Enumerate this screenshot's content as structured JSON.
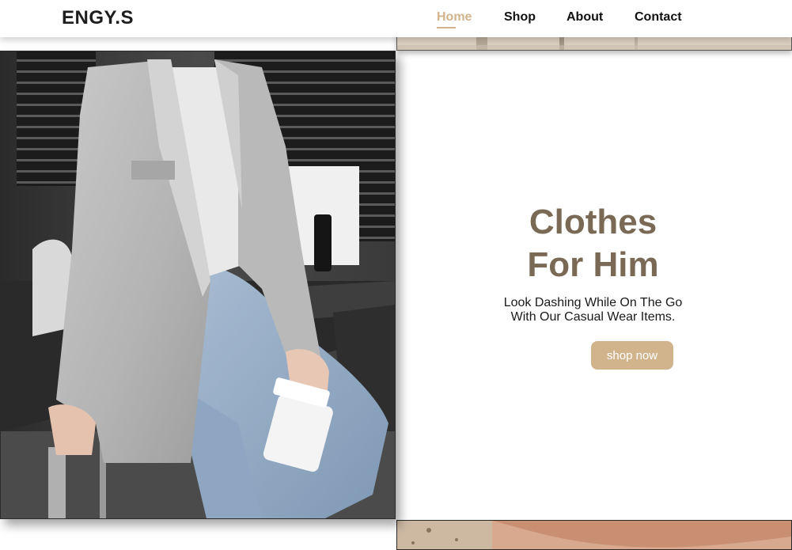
{
  "brand": {
    "logo": "ENGY.S",
    "accent_color": "#d2b48c",
    "title_color": "#7a6a55"
  },
  "nav": {
    "items": [
      {
        "label": "Home",
        "active": true
      },
      {
        "label": "Shop",
        "active": false
      },
      {
        "label": "About",
        "active": false
      },
      {
        "label": "Contact",
        "active": false
      }
    ]
  },
  "hero": {
    "title_line1": "Clothes",
    "title_line2": "For Him",
    "subtitle_line1": "Look Dashing While On The Go",
    "subtitle_line2": "With Our Casual Wear Items.",
    "cta_label": "shop now"
  },
  "images": {
    "main": "man-in-grey-blazer-with-coffee-photo",
    "top_strip": "beige-clothing-photo-strip",
    "bottom_strip": "skin-tone-photo-strip"
  }
}
